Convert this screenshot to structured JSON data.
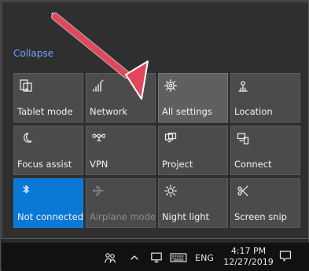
{
  "collapse_label": "Collapse",
  "tiles": [
    {
      "label": "Tablet mode",
      "icon": "tablet-mode-icon"
    },
    {
      "label": "Network",
      "icon": "network-icon"
    },
    {
      "label": "All settings",
      "icon": "gear-icon"
    },
    {
      "label": "Location",
      "icon": "location-icon"
    },
    {
      "label": "Focus assist",
      "icon": "moon-icon"
    },
    {
      "label": "VPN",
      "icon": "vpn-icon"
    },
    {
      "label": "Project",
      "icon": "project-icon"
    },
    {
      "label": "Connect",
      "icon": "connect-icon"
    },
    {
      "label": "Not connected",
      "icon": "bluetooth-icon"
    },
    {
      "label": "Airplane mode",
      "icon": "airplane-icon"
    },
    {
      "label": "Night light",
      "icon": "brightness-icon"
    },
    {
      "label": "Screen snip",
      "icon": "screen-snip-icon"
    }
  ],
  "taskbar": {
    "language": "ENG",
    "time": "4:17 PM",
    "date": "12/27/2019"
  },
  "colors": {
    "active_tile": "#0a78d7",
    "tile": "#4b4b4b",
    "link": "#6aa7ff",
    "arrow": "#e2475c"
  }
}
